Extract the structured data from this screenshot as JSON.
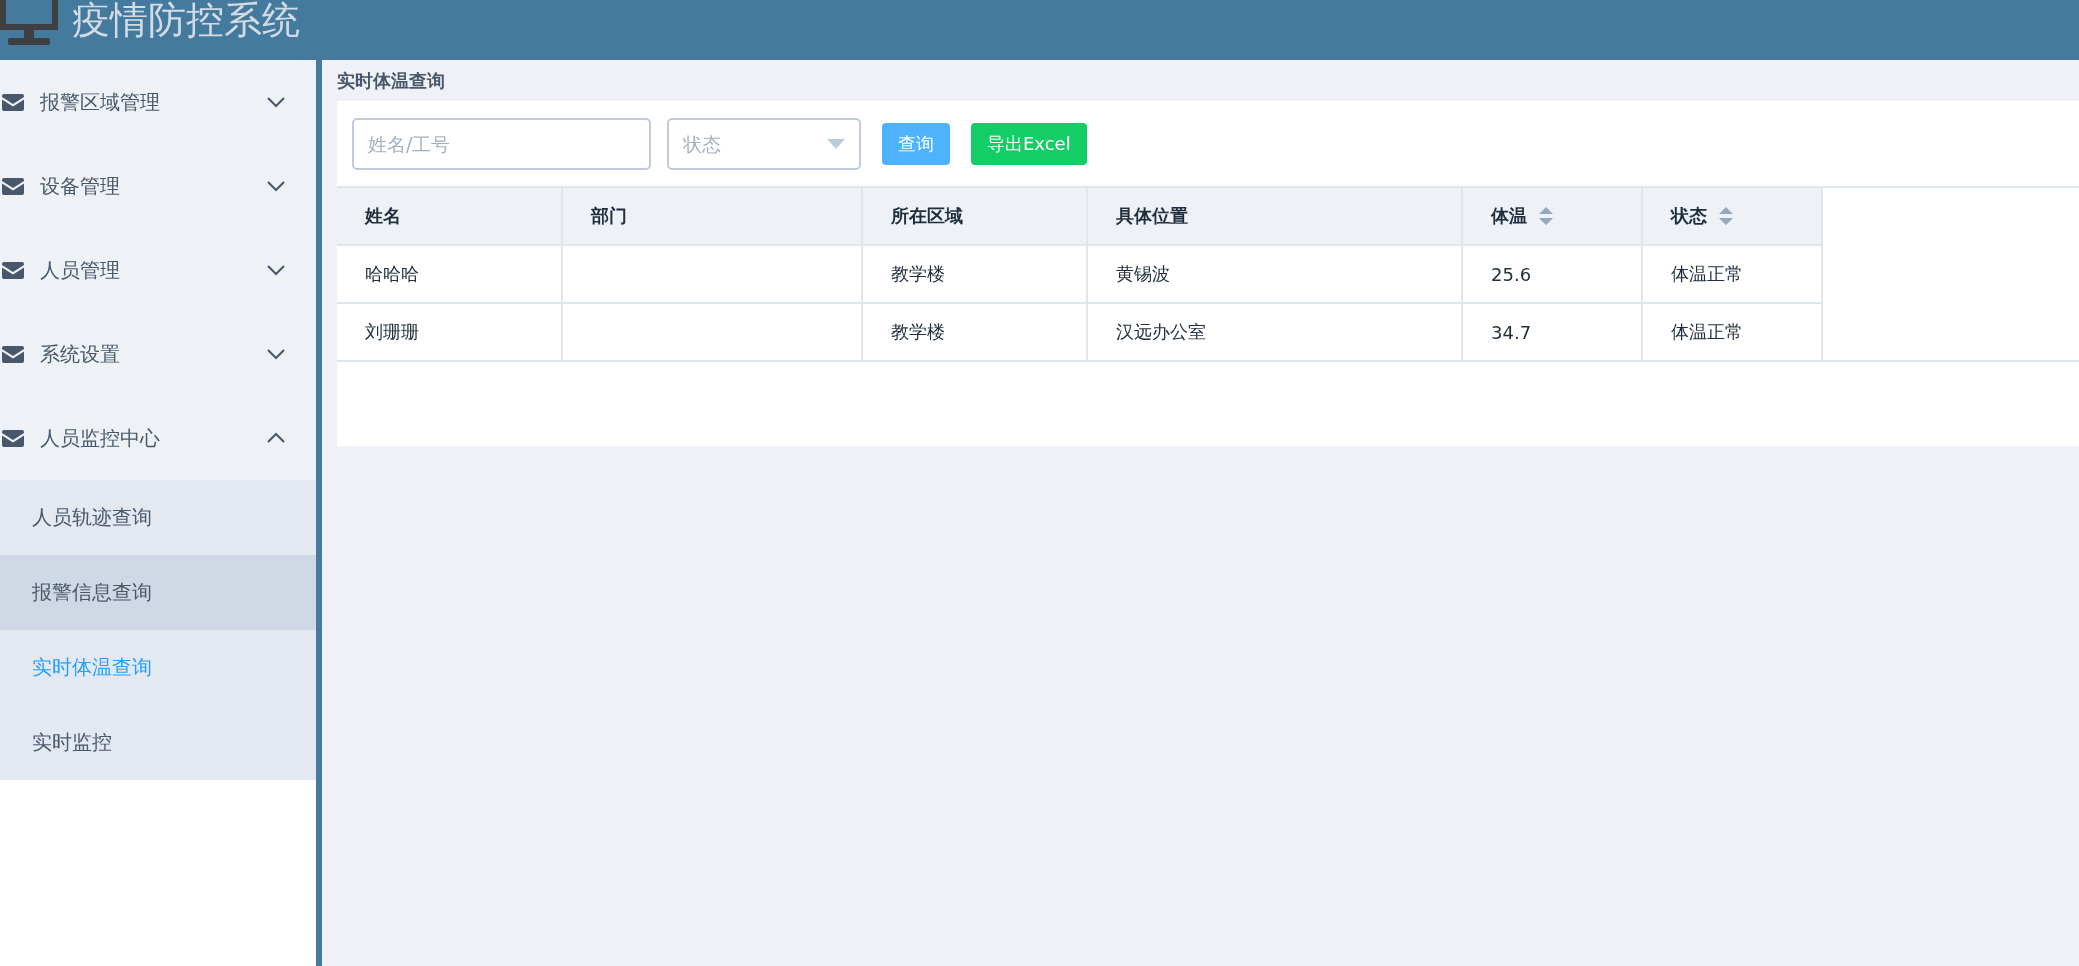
{
  "header": {
    "title": "疫情防控系统"
  },
  "sidebar": {
    "groups": [
      {
        "label": "报警区域管理",
        "expanded": false
      },
      {
        "label": "设备管理",
        "expanded": false
      },
      {
        "label": "人员管理",
        "expanded": false
      },
      {
        "label": "系统设置",
        "expanded": false
      },
      {
        "label": "人员监控中心",
        "expanded": true,
        "children": [
          {
            "label": "人员轨迹查询",
            "selected": false,
            "hovered": false
          },
          {
            "label": "报警信息查询",
            "selected": false,
            "hovered": true
          },
          {
            "label": "实时体温查询",
            "selected": true,
            "hovered": false
          },
          {
            "label": "实时监控",
            "selected": false,
            "hovered": false
          }
        ]
      }
    ]
  },
  "main": {
    "title": "实时体温查询",
    "filters": {
      "name": {
        "placeholder": "姓名/工号"
      },
      "status": {
        "placeholder": "状态"
      }
    },
    "buttons": [
      {
        "label": "查询",
        "kind": "primary"
      },
      {
        "label": "导出Excel",
        "kind": "success"
      }
    ],
    "table": {
      "columns": [
        {
          "label": "姓名",
          "sortable": false
        },
        {
          "label": "部门",
          "sortable": false
        },
        {
          "label": "所在区域",
          "sortable": false
        },
        {
          "label": "具体位置",
          "sortable": false
        },
        {
          "label": "体温",
          "sortable": true
        },
        {
          "label": "状态",
          "sortable": true
        }
      ],
      "rows": [
        [
          "哈哈哈",
          null,
          "教学楼",
          "黄锡波",
          "25.6",
          "体温正常"
        ],
        [
          "刘珊珊",
          null,
          "教学楼",
          "汉远办公室",
          "34.7",
          "体温正常"
        ]
      ]
    }
  }
}
